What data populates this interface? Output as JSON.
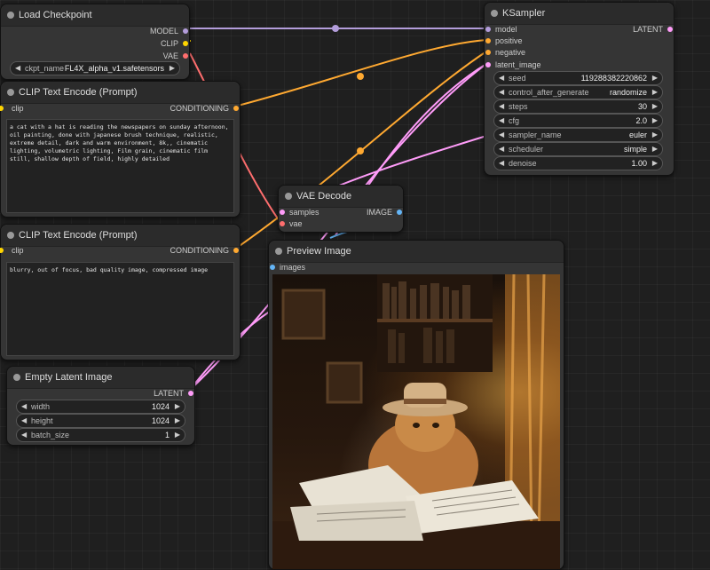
{
  "colors": {
    "model": "#b39ddb",
    "clip": "#ffd500",
    "vae": "#ff6e6e",
    "conditioning": "#ffa931",
    "latent": "#ff9cf9",
    "image": "#64b5f6"
  },
  "load_checkpoint": {
    "title": "Load Checkpoint",
    "outputs": {
      "model": "MODEL",
      "clip": "CLIP",
      "vae": "VAE"
    },
    "ckpt_label": "ckpt_name",
    "ckpt_value": "FL4X_alpha_v1.safetensors"
  },
  "clip_pos": {
    "title": "CLIP Text Encode (Prompt)",
    "input": "clip",
    "output": "CONDITIONING",
    "text": "a cat with a hat is reading the newspapers on sunday afternoon,  oil painting, done with japanese brush technique, realistic, extreme detail, dark and warm environment, 8k,, cinematic lighting, volumetric lighting, Film grain, cinematic film still, shallow depth of field, highly detailed"
  },
  "clip_neg": {
    "title": "CLIP Text Encode (Prompt)",
    "input": "clip",
    "output": "CONDITIONING",
    "text": "blurry, out of focus, bad quality image, compressed image"
  },
  "empty_latent": {
    "title": "Empty Latent Image",
    "output": "LATENT",
    "width_label": "width",
    "width_value": "1024",
    "height_label": "height",
    "height_value": "1024",
    "batch_label": "batch_size",
    "batch_value": "1"
  },
  "vae_decode": {
    "title": "VAE Decode",
    "input_samples": "samples",
    "input_vae": "vae",
    "output": "IMAGE"
  },
  "preview": {
    "title": "Preview Image",
    "input": "images"
  },
  "ksampler": {
    "title": "KSampler",
    "inputs": {
      "model": "model",
      "positive": "positive",
      "negative": "negative",
      "latent_image": "latent_image"
    },
    "output": "LATENT",
    "widgets": [
      {
        "label": "seed",
        "value": "119288382220862"
      },
      {
        "label": "control_after_generate",
        "value": "randomize"
      },
      {
        "label": "steps",
        "value": "30"
      },
      {
        "label": "cfg",
        "value": "2.0"
      },
      {
        "label": "sampler_name",
        "value": "euler"
      },
      {
        "label": "scheduler",
        "value": "simple"
      },
      {
        "label": "denoise",
        "value": "1.00"
      }
    ]
  }
}
